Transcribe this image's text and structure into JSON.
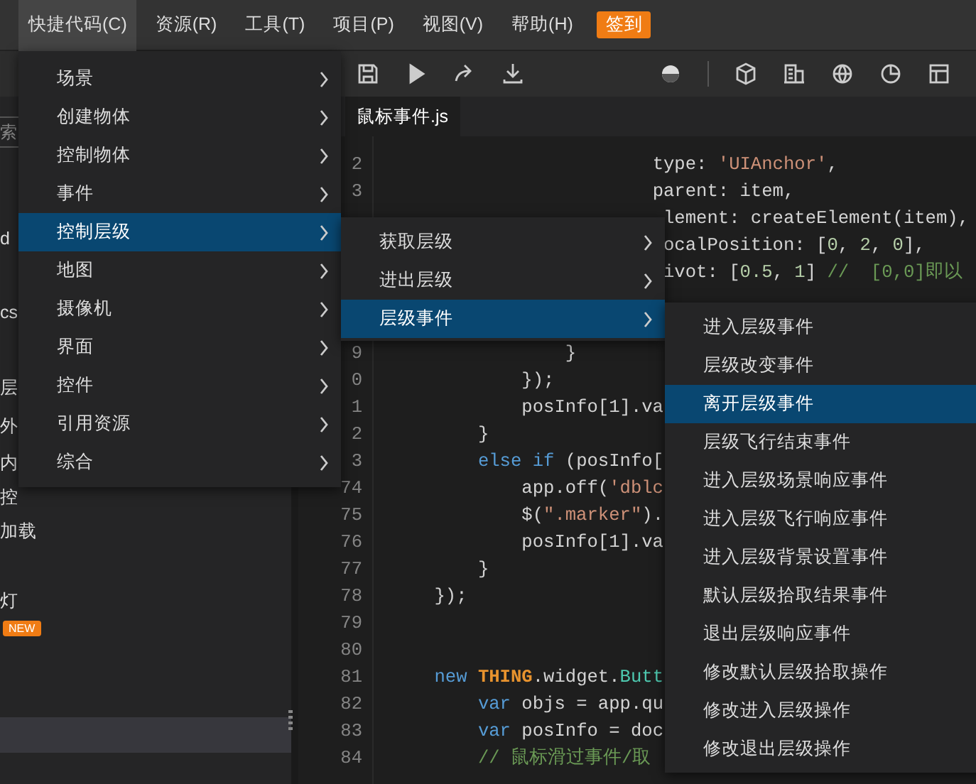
{
  "menu_bar": {
    "items": [
      {
        "label": "快捷代码(C)",
        "selected": true
      },
      {
        "label": "资源(R)",
        "selected": false
      },
      {
        "label": "工具(T)",
        "selected": false
      },
      {
        "label": "项目(P)",
        "selected": false
      },
      {
        "label": "视图(V)",
        "selected": false
      },
      {
        "label": "帮助(H)",
        "selected": false
      }
    ],
    "badge": "签到"
  },
  "tabs": [
    {
      "label": "鼠标事件.js",
      "selected": true
    }
  ],
  "left_panel": {
    "search_placeholder": "索",
    "items": [
      {
        "kind": "text",
        "text": "d"
      },
      {
        "kind": "text",
        "text": "cs"
      },
      {
        "kind": "text",
        "text": "层"
      },
      {
        "kind": "text",
        "text": "外"
      },
      {
        "kind": "text",
        "text": "内"
      },
      {
        "kind": "text",
        "text": "控"
      },
      {
        "kind": "text",
        "text": "加载"
      },
      {
        "kind": "text",
        "text": "灯"
      },
      {
        "kind": "badge",
        "text": "NEW"
      }
    ]
  },
  "editor": {
    "lines": [
      {
        "number": "2",
        "tokens": [
          {
            "kind": "plain",
            "text": "                        type: "
          },
          {
            "kind": "string",
            "text": "'UIAnchor'"
          },
          {
            "kind": "plain",
            "text": ","
          }
        ]
      },
      {
        "number": "3",
        "tokens": [
          {
            "kind": "plain",
            "text": "                        parent: item,"
          }
        ]
      },
      {
        "tokens": [
          {
            "kind": "plain",
            "text": "                         lement: createElement(item),"
          }
        ]
      },
      {
        "tokens": [
          {
            "kind": "plain",
            "text": "                         ocalPosition: ["
          },
          {
            "kind": "number",
            "text": "0"
          },
          {
            "kind": "plain",
            "text": ", "
          },
          {
            "kind": "number",
            "text": "2"
          },
          {
            "kind": "plain",
            "text": ", "
          },
          {
            "kind": "number",
            "text": "0"
          },
          {
            "kind": "plain",
            "text": "],"
          }
        ]
      },
      {
        "tokens": [
          {
            "kind": "plain",
            "text": "                         ivot: ["
          },
          {
            "kind": "number",
            "text": "0.5"
          },
          {
            "kind": "plain",
            "text": ", "
          },
          {
            "kind": "number",
            "text": "1"
          },
          {
            "kind": "plain",
            "text": "] "
          },
          {
            "kind": "comment",
            "text": "//  [0,0]即以"
          }
        ]
      },
      {
        "number": "9",
        "tokens": [
          {
            "kind": "plain",
            "text": "                }"
          }
        ]
      },
      {
        "number": "0",
        "tokens": [
          {
            "kind": "plain",
            "text": "            });"
          }
        ]
      },
      {
        "number": "1",
        "tokens": [
          {
            "kind": "plain",
            "text": "            posInfo[1].va"
          }
        ]
      },
      {
        "number": "2",
        "tokens": [
          {
            "kind": "plain",
            "text": "        }"
          }
        ]
      },
      {
        "number": "3",
        "tokens": [
          {
            "kind": "keyword",
            "text": "        else if"
          },
          {
            "kind": "plain",
            "text": " (posInfo["
          }
        ]
      },
      {
        "number": "74",
        "tokens": [
          {
            "kind": "plain",
            "text": "            app.off("
          },
          {
            "kind": "string",
            "text": "'dblc"
          }
        ]
      },
      {
        "number": "75",
        "tokens": [
          {
            "kind": "plain",
            "text": "            $("
          },
          {
            "kind": "string",
            "text": "\".marker\""
          },
          {
            "kind": "plain",
            "text": ")."
          }
        ]
      },
      {
        "number": "76",
        "tokens": [
          {
            "kind": "plain",
            "text": "            posInfo[1].va"
          }
        ]
      },
      {
        "number": "77",
        "tokens": [
          {
            "kind": "plain",
            "text": "        }"
          }
        ]
      },
      {
        "number": "78",
        "tokens": [
          {
            "kind": "plain",
            "text": "    });"
          }
        ]
      },
      {
        "number": "79"
      },
      {
        "number": "80"
      },
      {
        "number": "81",
        "tokens": [
          {
            "kind": "keyword",
            "text": "    new"
          },
          {
            "kind": "constant",
            "text": " THING"
          },
          {
            "kind": "plain",
            "text": ".widget."
          },
          {
            "kind": "class",
            "text": "Butt"
          }
        ]
      },
      {
        "number": "82",
        "tokens": [
          {
            "kind": "keyword",
            "text": "        var"
          },
          {
            "kind": "plain",
            "text": " objs = app.qu"
          }
        ]
      },
      {
        "number": "83",
        "tokens": [
          {
            "kind": "keyword",
            "text": "        var"
          },
          {
            "kind": "plain",
            "text": " posInfo = doc"
          }
        ]
      },
      {
        "number": "84",
        "tokens": [
          {
            "kind": "comment",
            "text": "        // 鼠标滑过事件/取"
          }
        ]
      }
    ]
  },
  "menu": {
    "items": [
      {
        "label": "场景",
        "selected": false
      },
      {
        "label": "创建物体",
        "selected": false
      },
      {
        "label": "控制物体",
        "selected": false
      },
      {
        "label": "事件",
        "selected": false
      },
      {
        "label": "控制层级",
        "selected": true
      },
      {
        "label": "地图",
        "selected": false
      },
      {
        "label": "摄像机",
        "selected": false
      },
      {
        "label": "界面",
        "selected": false
      },
      {
        "label": "控件",
        "selected": false
      },
      {
        "label": "引用资源",
        "selected": false
      },
      {
        "label": "综合",
        "selected": false
      }
    ]
  },
  "submenu": {
    "items": [
      {
        "label": "获取层级",
        "selected": false
      },
      {
        "label": "进出层级",
        "selected": false
      },
      {
        "label": "层级事件",
        "selected": true
      }
    ]
  },
  "submenu_2": {
    "items": [
      {
        "label": "进入层级事件",
        "selected": false
      },
      {
        "label": "层级改变事件",
        "selected": false
      },
      {
        "label": "离开层级事件",
        "selected": true
      },
      {
        "label": "层级飞行结束事件",
        "selected": false
      },
      {
        "label": "进入层级场景响应事件",
        "selected": false
      },
      {
        "label": "进入层级飞行响应事件",
        "selected": false
      },
      {
        "label": "进入层级背景设置事件",
        "selected": false
      },
      {
        "label": "默认层级拾取结果事件",
        "selected": false
      },
      {
        "label": "退出层级响应事件",
        "selected": false
      },
      {
        "label": "修改默认层级拾取操作",
        "selected": false
      },
      {
        "label": "修改进入层级操作",
        "selected": false
      },
      {
        "label": "修改退出层级操作",
        "selected": false
      }
    ]
  }
}
